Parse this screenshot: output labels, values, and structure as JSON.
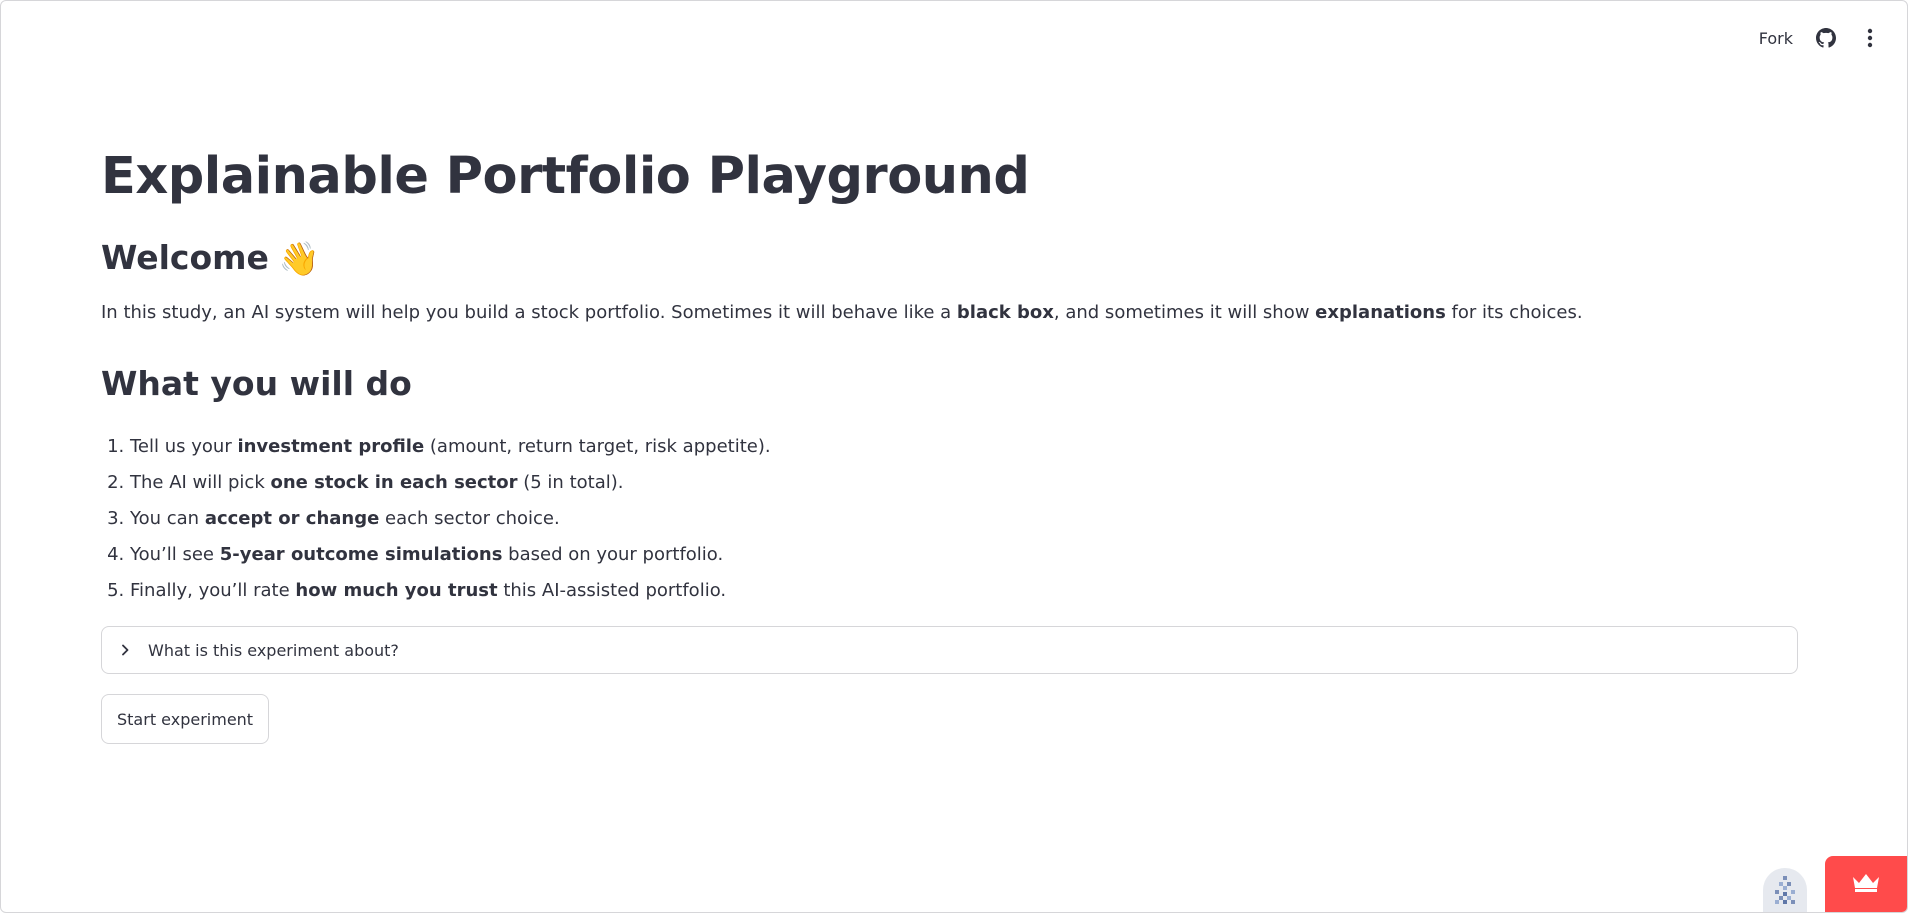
{
  "toolbar": {
    "fork_label": "Fork",
    "github_icon": "github-icon",
    "menu_icon": "more-vertical-icon"
  },
  "main": {
    "title": "Explainable Portfolio Playground",
    "welcome_heading": "Welcome",
    "welcome_emoji": "👋",
    "intro": {
      "part1": "In this study, an AI system will help you build a stock portfolio. Sometimes it will behave like a ",
      "bold1": "black box",
      "part2": ", and sometimes it will show ",
      "bold2": "explanations",
      "part3": " for its choices."
    },
    "steps_heading": "What you will do",
    "steps": [
      {
        "pre": "Tell us your ",
        "bold": "investment profile",
        "post": " (amount, return target, risk appetite)."
      },
      {
        "pre": "The AI will pick ",
        "bold": "one stock in each sector",
        "post": " (5 in total)."
      },
      {
        "pre": "You can ",
        "bold": "accept or change",
        "post": " each sector choice."
      },
      {
        "pre": "You’ll see ",
        "bold": "5-year outcome simulations",
        "post": " based on your portfolio."
      },
      {
        "pre": "Finally, you’ll rate ",
        "bold": "how much you trust",
        "post": " this AI-assisted portfolio."
      }
    ],
    "expander_label": "What is this experiment about?",
    "start_button": "Start experiment"
  },
  "colors": {
    "text": "#31333f",
    "border": "#d6d6d9",
    "badge": "#ff4b4b"
  }
}
